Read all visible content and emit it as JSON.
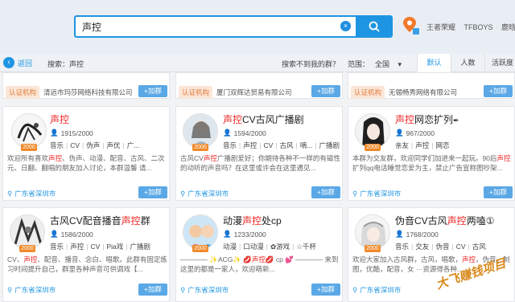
{
  "search": {
    "query": "声控",
    "clear": "×"
  },
  "hot_words": [
    "王者荣耀",
    "TFBOYS",
    "鹿晗"
  ],
  "filter": {
    "back": "返回",
    "search_label": "搜索：声控",
    "not_found": "搜索不到我的群？",
    "range_label": "范围：",
    "range_value": "全国",
    "tabs": [
      "默认",
      "人数",
      "活跃度"
    ]
  },
  "top_cards": [
    {
      "badge": "认证机构",
      "company": "清远市玛莎网络科技有限公司",
      "join": "+加群"
    },
    {
      "badge": "认证机构",
      "company": "厦门双辉达贸易有限公司",
      "join": "+加群"
    },
    {
      "badge": "认证机构",
      "company": "无锡畅秀网络有限公司",
      "join": "+加群"
    }
  ],
  "cards": [
    {
      "title_pre": "",
      "title_hl": "声控",
      "title_post": "",
      "level": "2000",
      "count": "1915/2000",
      "tags": [
        "音乐",
        "CV",
        "伪声",
        "声优",
        "广..."
      ],
      "desc_pre": "欢迎所有喜欢",
      "desc_hl": "声控",
      "desc_post": "、伪声、动漫、配音、古风、二次元、日翻、翻唱的朋友加入讨论，本群温馨 请...",
      "loc": "广东省深圳市",
      "join": "+加群"
    },
    {
      "title_pre": "",
      "title_hl": "声控",
      "title_post": "CV古风广播剧",
      "level": "2000",
      "count": "1594/2000",
      "tags": [
        "音乐",
        "声控",
        "CV",
        "古风",
        "嘀...",
        "广播剧"
      ],
      "desc_pre": "古风CV",
      "desc_hl": "声控",
      "desc_post": "广播剧爱好；你期待各种不一样的有磁性的动听的声音吗？在这里或许会在这里遇见...",
      "loc": "广东省深圳市",
      "join": "+加群"
    },
    {
      "title_pre": "",
      "title_hl": "声控",
      "title_post": "网恋扩列",
      "level": "2000",
      "count": "967/2000",
      "tags": [
        "亲友",
        "声控",
        "网恋"
      ],
      "desc_pre": "本群为交友群，欢迎同学们加进来一起玩。90后",
      "desc_hl": "声控",
      "desc_post": "扩列qq电话睡觉恋爱为主，禁止广告宣称图吵架...",
      "loc": "广东省深圳市",
      "join": "+加群"
    },
    {
      "title_pre": "古风CV配音播音",
      "title_hl": "声控",
      "title_post": "群",
      "level": "2000",
      "count": "1586/2000",
      "tags": [
        "音乐",
        "声控",
        "CV",
        "Pia戏",
        "广播剧"
      ],
      "desc_pre": "CV、",
      "desc_hl": "声控",
      "desc_post": "、配音、播音、念白、唱歌。此群有固定练习时间提升自己，群里各种声音可供调戏【...",
      "loc": "广东省深圳市",
      "join": "+加群"
    },
    {
      "title_pre": "动漫",
      "title_hl": "声控",
      "title_post": "处cp",
      "level": "2000",
      "count": "1233/2000",
      "tags": [
        "动漫",
        "口动漫",
        "✿游戏",
        "☆千杯"
      ],
      "desc_pre": "———— ✨ACG✨ 💋",
      "desc_hl": "声控",
      "desc_post": "💋 cp 💕 ———— 来到这里的都是一家人，欢迎萌新...",
      "loc": "广东省深圳市",
      "join": "+加群"
    },
    {
      "title_pre": "伪音CV古风",
      "title_hl": "声控",
      "title_post": "两嗑①",
      "level": "2000",
      "count": "1768/2000",
      "tags": [
        "音乐",
        "交友",
        "伪音",
        "CV",
        "古风"
      ],
      "desc_pre": "欢迎大家加入古风群，古风，唱歌，",
      "desc_hl": "声控",
      "desc_post": "，伪音，制图，优酷，配音，女 ···资源得各种...",
      "loc": "广东省深圳市",
      "join": "+加群"
    }
  ],
  "watermark": "大飞赚钱项目"
}
